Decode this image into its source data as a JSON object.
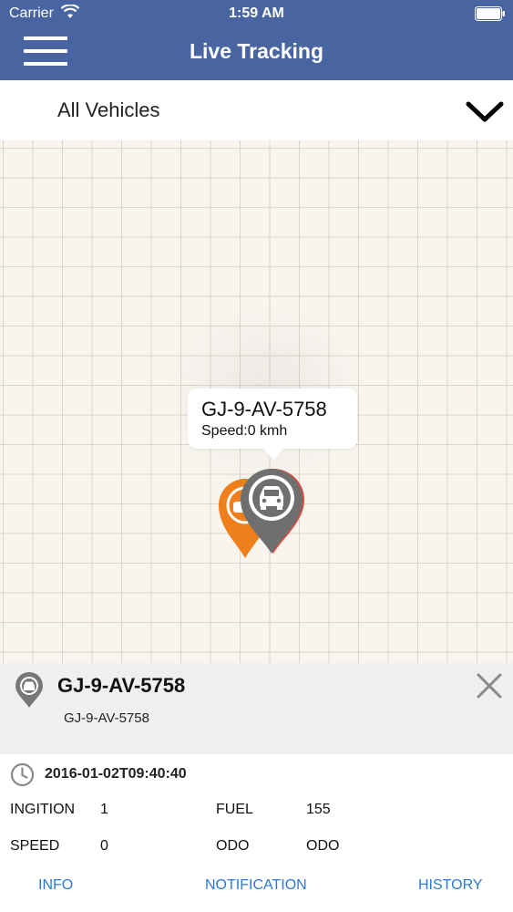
{
  "status_bar": {
    "carrier": "Carrier",
    "time": "1:59 AM"
  },
  "nav": {
    "title": "Live Tracking"
  },
  "selector": {
    "value": "All Vehicles"
  },
  "map": {
    "callout_title": "GJ-9-AV-5758",
    "callout_speed": "Speed:0 kmh"
  },
  "vehicle_panel": {
    "title": "GJ-9-AV-5758",
    "subtitle": "GJ-9-AV-5758"
  },
  "info": {
    "timestamp": "2016-01-02T09:40:40",
    "ignition_label": "INGITION",
    "ignition_value": "1",
    "fuel_label": "FUEL",
    "fuel_value": "155",
    "speed_label": "SPEED",
    "speed_value": "0",
    "odo_label": "ODO",
    "odo_value": "ODO"
  },
  "tabs": {
    "info": "INFO",
    "notification": "NOTIFICATION",
    "history": "HISTORY"
  },
  "colors": {
    "nav_bar": "#4865a2",
    "tab_link": "#2c79d8",
    "marker_orange": "#ef7e1c",
    "marker_grey": "#6f6f6f"
  },
  "icons": [
    "wifi-icon",
    "battery-icon",
    "menu-icon",
    "chevron-down-icon",
    "car-marker-icon",
    "car-pin-icon",
    "close-icon",
    "clock-icon"
  ]
}
